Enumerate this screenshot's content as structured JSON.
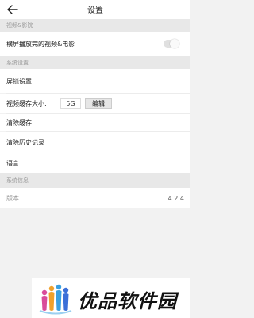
{
  "titlebar": {
    "title": "设置"
  },
  "sections": {
    "video": {
      "header": "视频&影院",
      "landscape_label": "横屏播放完的视频&电影",
      "landscape_enabled": false
    },
    "system": {
      "header": "系统设置",
      "lockscreen_label": "屏锁设置",
      "cache_size_label": "视频缓存大小:",
      "cache_size_value": "5G",
      "edit_label": "编辑",
      "clear_cache_label": "清除缓存",
      "clear_history_label": "清除历史记录",
      "language_label": "语言"
    },
    "info": {
      "header": "系统信息",
      "version_label": "版本",
      "version_value": "4.2.4"
    }
  },
  "watermark": {
    "text": "优品软件园"
  },
  "colors": {
    "header_bg": "#e8e8e8",
    "header_text": "#999999"
  }
}
